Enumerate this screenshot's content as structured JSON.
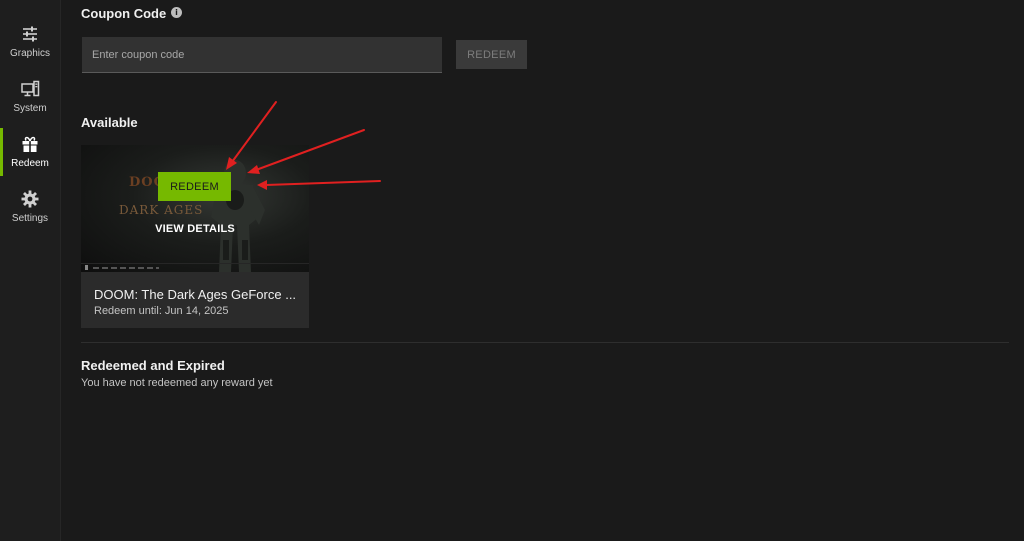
{
  "sidebar": {
    "items": [
      {
        "label": "Graphics",
        "icon": "sliders-icon",
        "active": false
      },
      {
        "label": "System",
        "icon": "monitor-computer-icon",
        "active": false
      },
      {
        "label": "Redeem",
        "icon": "gift-icon",
        "active": true
      },
      {
        "label": "Settings",
        "icon": "gear-icon",
        "active": false
      }
    ]
  },
  "coupon": {
    "title": "Coupon Code",
    "info_icon": "info-icon",
    "placeholder": "Enter coupon code",
    "button_label": "REDEEM"
  },
  "available": {
    "title": "Available",
    "rewards": [
      {
        "art_logo": "DOOM",
        "art_subtitle": "DARK AGES",
        "redeem_label": "REDEEM",
        "details_label": "VIEW DETAILS",
        "title": "DOOM: The Dark Ages GeForce ...",
        "expiry": "Redeem until: Jun 14, 2025"
      }
    ]
  },
  "redeemed": {
    "title": "Redeemed and Expired",
    "empty_message": "You have not redeemed any reward yet"
  },
  "colors": {
    "accent": "#76b900",
    "background": "#1a1a1a",
    "annotation_arrow": "#e02020"
  }
}
